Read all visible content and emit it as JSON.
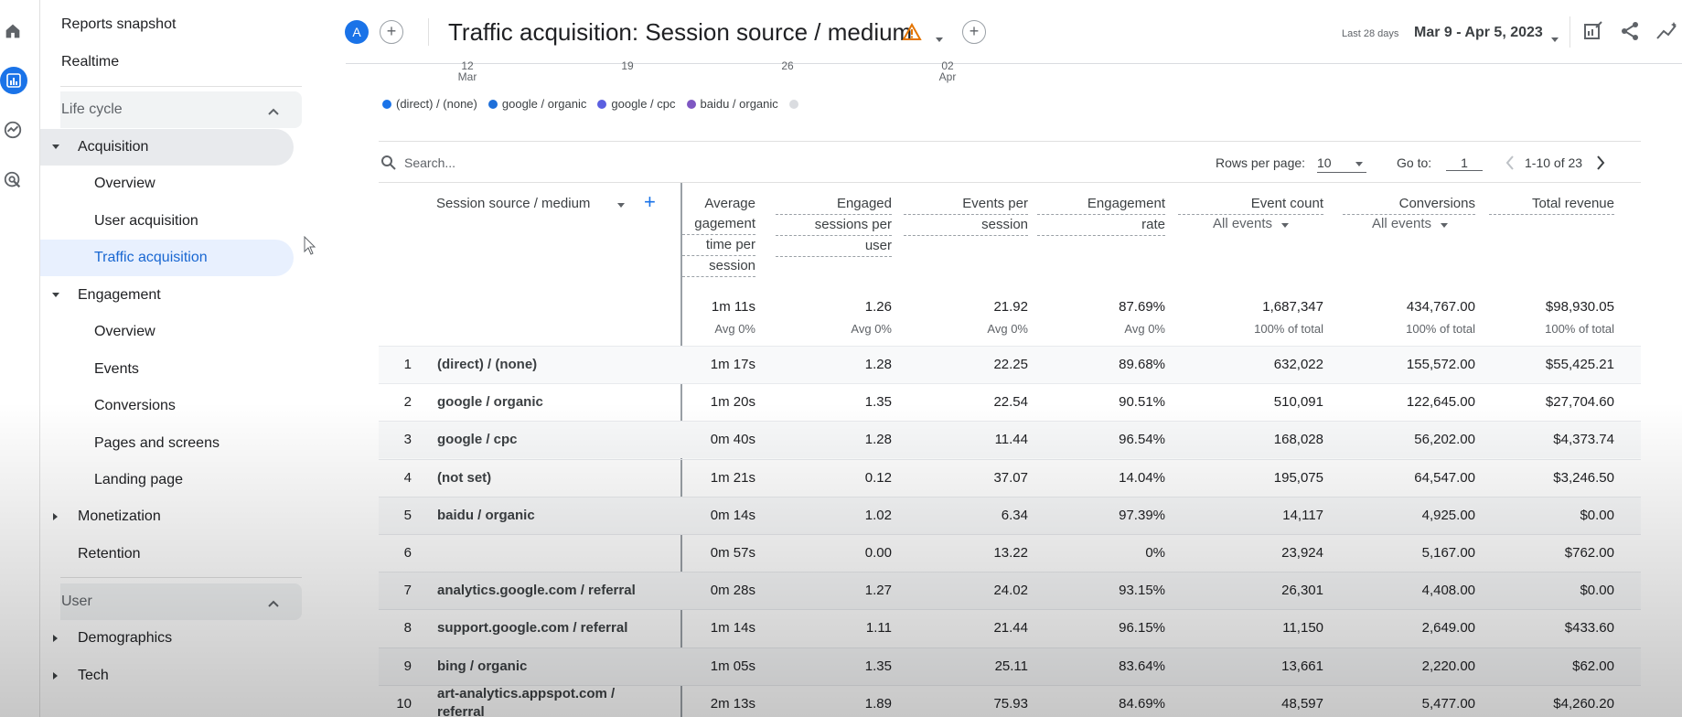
{
  "sidebar": {
    "top_items": [
      "Reports snapshot",
      "Realtime"
    ],
    "lifecycle_label": "Life cycle",
    "acquisition": {
      "label": "Acquisition",
      "children": [
        "Overview",
        "User acquisition",
        "Traffic acquisition"
      ]
    },
    "engagement": {
      "label": "Engagement",
      "children": [
        "Overview",
        "Events",
        "Conversions",
        "Pages and screens",
        "Landing page"
      ]
    },
    "monetization": "Monetization",
    "retention": "Retention",
    "user_label": "User",
    "demographics": "Demographics",
    "tech": "Tech"
  },
  "header": {
    "avatar_letter": "A",
    "title": "Traffic acquisition: Session source / medium",
    "date_small": "Last 28 days",
    "date_range": "Mar 9 - Apr 5, 2023"
  },
  "chart_axis": {
    "ticks": [
      {
        "day": "12",
        "month": "Mar"
      },
      {
        "day": "19",
        "month": ""
      },
      {
        "day": "26",
        "month": ""
      },
      {
        "day": "02",
        "month": "Apr"
      }
    ]
  },
  "legend": [
    {
      "label": "(direct) / (none)",
      "color": "#1a73e8"
    },
    {
      "label": "google / organic",
      "color": "#1e6fd9"
    },
    {
      "label": "google / cpc",
      "color": "#5b5fe0"
    },
    {
      "label": "baidu / organic",
      "color": "#7e57c2"
    },
    {
      "label": "",
      "color": "#dadce0"
    }
  ],
  "toolbar": {
    "search_placeholder": "Search...",
    "rows_per_page_label": "Rows per page:",
    "rows_per_page_value": "10",
    "goto_label": "Go to:",
    "goto_value": "1",
    "pagination": "1-10 of 23"
  },
  "table": {
    "dimension_header": "Session source / medium",
    "columns": [
      {
        "lines": [
          "Average",
          "gagement",
          "time per",
          "session"
        ],
        "sub": ""
      },
      {
        "lines": [
          "Engaged",
          "sessions per",
          "user"
        ],
        "sub": ""
      },
      {
        "lines": [
          "Events per",
          "session"
        ],
        "sub": ""
      },
      {
        "lines": [
          "Engagement",
          "rate"
        ],
        "sub": ""
      },
      {
        "lines": [
          "Event count"
        ],
        "sub": "All events"
      },
      {
        "lines": [
          "Conversions"
        ],
        "sub": "All events"
      },
      {
        "lines": [
          "Total revenue"
        ],
        "sub": ""
      }
    ],
    "totals": [
      "1m 11s",
      "1.26",
      "21.92",
      "87.69%",
      "1,687,347",
      "434,767.00",
      "$98,930.05"
    ],
    "totals_sub": [
      "Avg 0%",
      "Avg 0%",
      "Avg 0%",
      "Avg 0%",
      "100% of total",
      "100% of total",
      "100% of total"
    ],
    "rows": [
      {
        "idx": "1",
        "name": "(direct) / (none)",
        "vals": [
          "1m 17s",
          "1.28",
          "22.25",
          "89.68%",
          "632,022",
          "155,572.00",
          "$55,425.21"
        ]
      },
      {
        "idx": "2",
        "name": "google / organic",
        "vals": [
          "1m 20s",
          "1.35",
          "22.54",
          "90.51%",
          "510,091",
          "122,645.00",
          "$27,704.60"
        ]
      },
      {
        "idx": "3",
        "name": "google / cpc",
        "vals": [
          "0m 40s",
          "1.28",
          "11.44",
          "96.54%",
          "168,028",
          "56,202.00",
          "$4,373.74"
        ]
      },
      {
        "idx": "4",
        "name": "(not set)",
        "vals": [
          "1m 21s",
          "0.12",
          "37.07",
          "14.04%",
          "195,075",
          "64,547.00",
          "$3,246.50"
        ]
      },
      {
        "idx": "5",
        "name": "baidu / organic",
        "vals": [
          "0m 14s",
          "1.02",
          "6.34",
          "97.39%",
          "14,117",
          "4,925.00",
          "$0.00"
        ]
      },
      {
        "idx": "6",
        "name": "",
        "vals": [
          "0m 57s",
          "0.00",
          "13.22",
          "0%",
          "23,924",
          "5,167.00",
          "$762.00"
        ]
      },
      {
        "idx": "7",
        "name": "analytics.google.com / referral",
        "vals": [
          "0m 28s",
          "1.27",
          "24.02",
          "93.15%",
          "26,301",
          "4,408.00",
          "$0.00"
        ]
      },
      {
        "idx": "8",
        "name": "support.google.com / referral",
        "vals": [
          "1m 14s",
          "1.11",
          "21.44",
          "96.15%",
          "11,150",
          "2,649.00",
          "$433.60"
        ]
      },
      {
        "idx": "9",
        "name": "bing / organic",
        "vals": [
          "1m 05s",
          "1.35",
          "25.11",
          "83.64%",
          "13,661",
          "2,220.00",
          "$62.00"
        ]
      },
      {
        "idx": "10",
        "name": "art-analytics.appspot.com / referral",
        "vals": [
          "2m 13s",
          "1.89",
          "75.93",
          "84.69%",
          "48,597",
          "5,477.00",
          "$4,260.20"
        ]
      }
    ]
  }
}
